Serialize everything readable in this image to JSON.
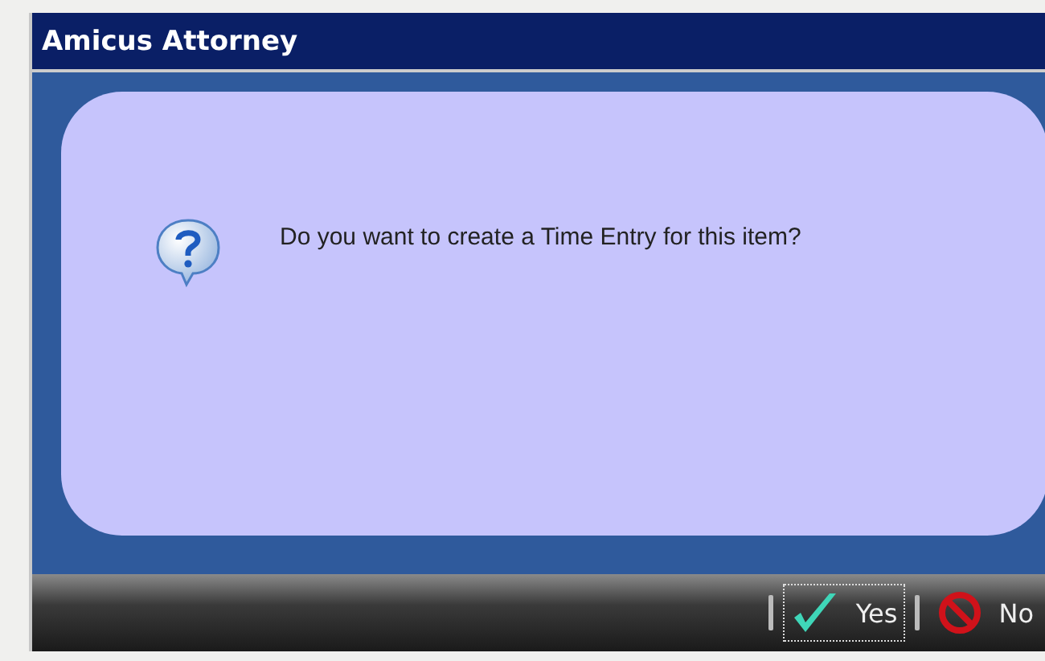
{
  "window": {
    "title": "Amicus Attorney"
  },
  "message": "Do you want to create a Time Entry for this item?",
  "buttons": [
    {
      "kind": "yes",
      "label": "Yes",
      "focused": true
    },
    {
      "kind": "no",
      "label": "No",
      "focused": false
    }
  ]
}
